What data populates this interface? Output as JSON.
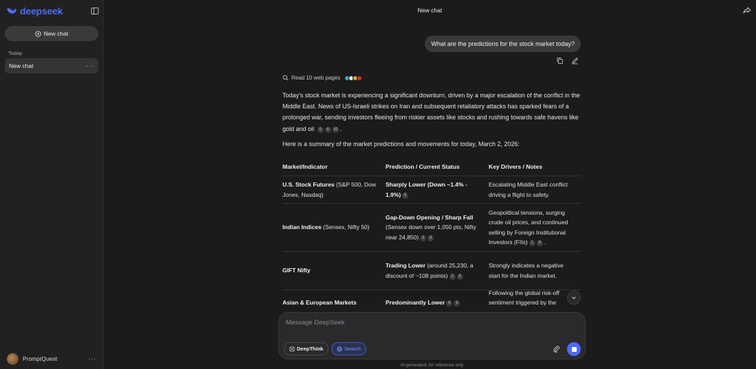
{
  "app": {
    "brand": "deepseek",
    "accent": "#4d6bfe"
  },
  "sidebar": {
    "new_chat_label": "New chat",
    "section_today": "Today",
    "history": [
      {
        "label": "New chat"
      }
    ],
    "more_glyph": "···",
    "user": {
      "name": "PromptQuest"
    }
  },
  "header": {
    "title": "New chat"
  },
  "user_message": "What are the predictions for the stock market today?",
  "assistant": {
    "read_pages": "Read 10 web pages",
    "para1": "Today's stock market is experiencing a significant downturn, driven by a major escalation of the conflict in the Middle East. News of US-Israeli strikes on Iran and subsequent retaliatory attacks has sparked fears of a prolonged war, sending investors fleeing from riskier assets like stocks and rushing towards safe havens like gold and oil",
    "para1_cites": [
      "5",
      "6",
      "10"
    ],
    "para1_end": ".",
    "summary": "Here is a summary of the market predictions and movements for today, March 2, 2026:",
    "table": {
      "headers": [
        "Market/Indicator",
        "Prediction / Current Status",
        "Key Drivers / Notes"
      ],
      "rows": [
        {
          "market_bold": "U.S. Stock Futures",
          "market_rest": " (S&P 500, Dow Jones, Nasdaq)",
          "pred_bold": "Sharply Lower (Down ~1.4% - 1.9%)",
          "pred_rest": "",
          "pred_cites": [
            "5"
          ],
          "drivers": "Escalating Middle East conflict driving a flight to safety.",
          "drivers_cites": []
        },
        {
          "market_bold": "Indian Indices",
          "market_rest": " (Sensex, Nifty 50)",
          "pred_bold": "Gap-Down Opening / Sharp Fall",
          "pred_rest": " (Sensex down over 1,050 pts, Nifty near 24,850)",
          "pred_cites": [
            "3",
            "9"
          ],
          "drivers": "Geopolitical tensions, surging crude oil prices, and continued selling by Foreign Institutional Investors (FIIs)",
          "drivers_cites": [
            "1",
            "6"
          ],
          "drivers_end": "."
        },
        {
          "market_bold": "GIFT Nifty",
          "market_rest": "",
          "pred_bold": "Trading Lower",
          "pred_rest": " (around 25,230, a discount of ~108 points)",
          "pred_cites": [
            "3",
            "6"
          ],
          "drivers": "Strongly indicates a negative start for the Indian market.",
          "drivers_cites": []
        },
        {
          "market_bold": "Asian & European Markets",
          "market_rest": "",
          "pred_bold": "Predominantly Lower",
          "pred_rest": "",
          "pred_cites": [
            "6",
            "9"
          ],
          "drivers": "Following the global risk-off sentiment triggered by the",
          "drivers_cites": []
        }
      ]
    }
  },
  "composer": {
    "placeholder": "Message DeepSeek",
    "deepthink_label": "DeepThink",
    "search_label": "Search"
  },
  "disclaimer": "AI-generated, for reference only"
}
